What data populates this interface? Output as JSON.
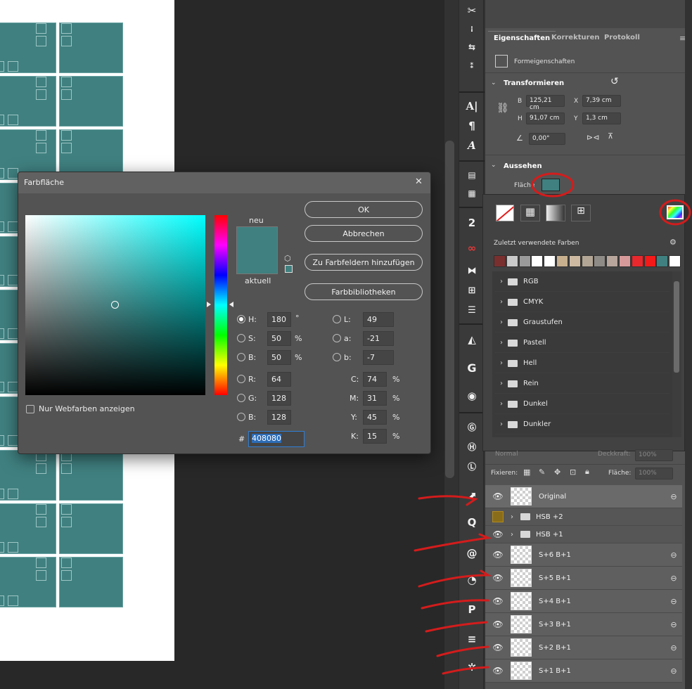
{
  "panel": {
    "tabs": [
      "Eigenschaften",
      "Korrekturen",
      "Protokoll"
    ],
    "shape_props_label": "Formeigenschaften",
    "transform": {
      "title": "Transformieren",
      "B_label": "B",
      "B_value": "125,21 cm",
      "X_label": "X",
      "X_value": "7,39 cm",
      "H_label": "H",
      "H_value": "91,07 cm",
      "Y_label": "Y",
      "Y_value": "1,3 cm",
      "angle_value": "0,00°"
    },
    "appearance": {
      "title": "Aussehen",
      "fill_label": "Fläche",
      "fill_color": "#408080"
    }
  },
  "swatch_popup": {
    "recent_label": "Zuletzt verwendete Farben",
    "recent_colors": [
      "#7a2f2f",
      "#c9c9c9",
      "#9a9a9a",
      "#ffffff",
      "#ffffff",
      "#c8b08f",
      "#cdb9a2",
      "#b3a695",
      "#8e8a86",
      "#b8a59b",
      "#d79a9a",
      "#e8282d",
      "#f41a1a",
      "#408080",
      "#ffffff"
    ],
    "groups": [
      "RGB",
      "CMYK",
      "Graustufen",
      "Pastell",
      "Hell",
      "Rein",
      "Dunkel",
      "Dunkler"
    ]
  },
  "layers": {
    "blend_mode": "Normal",
    "opacity_label": "Deckkraft:",
    "opacity_value": "100%",
    "lock_label": "Fixieren:",
    "fill_label": "Fläche:",
    "fill_value": "100%",
    "items": [
      {
        "name": "Original",
        "type": "layer"
      },
      {
        "name": "HSB +2",
        "type": "group"
      },
      {
        "name": "HSB +1",
        "type": "group"
      },
      {
        "name": "S+6 B+1",
        "type": "layer"
      },
      {
        "name": "S+5 B+1",
        "type": "layer"
      },
      {
        "name": "S+4 B+1",
        "type": "layer"
      },
      {
        "name": "S+3 B+1",
        "type": "layer"
      },
      {
        "name": "S+2 B+1",
        "type": "layer"
      },
      {
        "name": "S+1 B+1",
        "type": "layer"
      }
    ]
  },
  "dialog": {
    "title": "Farbfläche",
    "close": "✕",
    "new_label": "neu",
    "current_label": "aktuell",
    "new_color": "#408080",
    "current_color": "#408080",
    "buttons": {
      "ok": "OK",
      "cancel": "Abbrechen",
      "add_swatch": "Zu Farbfeldern hinzufügen",
      "libraries": "Farbbibliotheken"
    },
    "web_colors_label": "Nur Webfarben anzeigen",
    "hsb": {
      "H": "180",
      "S": "50",
      "B": "50"
    },
    "rgb": {
      "R": "64",
      "G": "128",
      "B": "128"
    },
    "lab": {
      "L": "49",
      "a": "-21",
      "b": "-7"
    },
    "cmyk": {
      "C": "74",
      "M": "31",
      "Y": "45",
      "K": "15"
    },
    "hex": "408080",
    "labels": {
      "H": "H:",
      "S": "S:",
      "Bv": "B:",
      "R": "R:",
      "G": "G:",
      "Bb": "B:",
      "L": "L:",
      "a": "a:",
      "b": "b:",
      "C": "C:",
      "M": "M:",
      "Y": "Y:",
      "K": "K:",
      "hash": "#"
    },
    "units": {
      "deg": "°",
      "pct": "%"
    }
  },
  "colors": {
    "teal": "#408080",
    "annotation_red": "#d41c1c"
  }
}
